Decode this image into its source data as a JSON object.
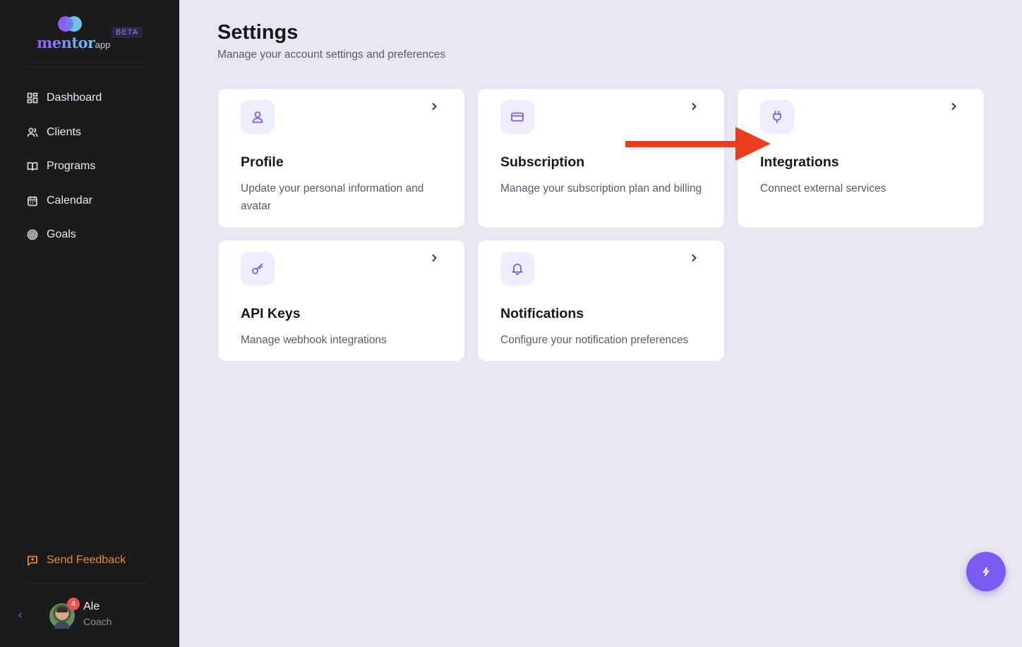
{
  "brand": {
    "logo_text": "mentor",
    "logo_suffix": "app",
    "beta_label": "BETA"
  },
  "sidebar": {
    "items": [
      {
        "label": "Dashboard",
        "icon": "dashboard-icon"
      },
      {
        "label": "Clients",
        "icon": "users-icon"
      },
      {
        "label": "Programs",
        "icon": "book-icon"
      },
      {
        "label": "Calendar",
        "icon": "calendar-icon"
      },
      {
        "label": "Goals",
        "icon": "target-icon"
      }
    ],
    "feedback_label": "Send Feedback",
    "collapse_icon": "chevron-left-icon",
    "user": {
      "name": "Ale",
      "role": "Coach",
      "notification_count": "4"
    }
  },
  "page": {
    "title": "Settings",
    "subtitle": "Manage your account settings and preferences"
  },
  "cards": [
    {
      "title": "Profile",
      "description": "Update your personal information and avatar",
      "icon": "user-icon"
    },
    {
      "title": "Subscription",
      "description": "Manage your subscription plan and billing",
      "icon": "credit-card-icon"
    },
    {
      "title": "Integrations",
      "description": "Connect external services",
      "icon": "plug-icon"
    },
    {
      "title": "API Keys",
      "description": "Manage webhook integrations",
      "icon": "key-icon"
    },
    {
      "title": "Notifications",
      "description": "Configure your notification preferences",
      "icon": "bell-icon"
    }
  ],
  "fab_icon": "lightning-icon",
  "annotation": {
    "arrow_color": "#e8401c"
  },
  "colors": {
    "accent": "#7b5cf0",
    "sidebar_bg": "#1b1b1d",
    "page_bg": "#e8e6f1",
    "feedback": "#e58a2c"
  }
}
